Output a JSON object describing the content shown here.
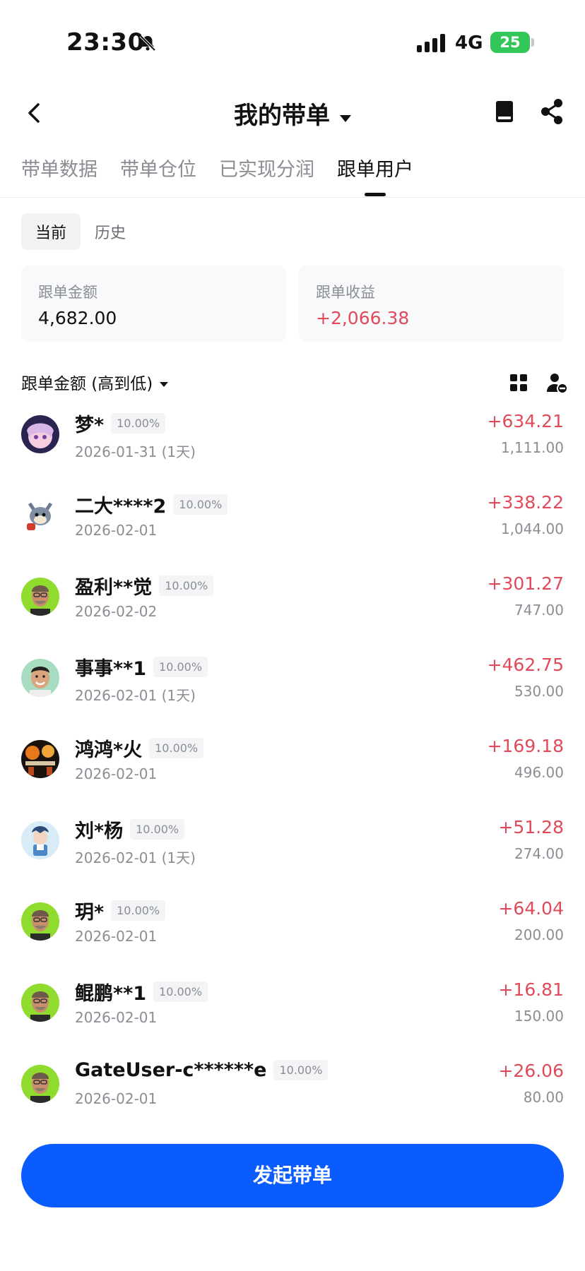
{
  "status_bar": {
    "time": "23:30",
    "network": "4G",
    "battery": "25"
  },
  "header": {
    "title": "我的带单"
  },
  "tabs": [
    {
      "label": "带单数据",
      "active": false
    },
    {
      "label": "带单仓位",
      "active": false
    },
    {
      "label": "已实现分润",
      "active": false
    },
    {
      "label": "跟单用户",
      "active": true
    }
  ],
  "segment": {
    "current": "当前",
    "history": "历史",
    "selected": "当前"
  },
  "summary": {
    "amount_label": "跟单金额",
    "amount_value": "4,682.00",
    "profit_label": "跟单收益",
    "profit_value": "+2,066.38"
  },
  "sort": {
    "label": "跟单金额 (高到低)"
  },
  "followers": [
    {
      "name": "梦*",
      "ratio": "10.00%",
      "date": "2026-01-31 (1天)",
      "profit": "+634.21",
      "amount": "1,111.00",
      "avatar": "anime-girl-avatar"
    },
    {
      "name": "二大****2",
      "ratio": "10.00%",
      "date": "2026-02-01",
      "profit": "+338.22",
      "amount": "1,044.00",
      "avatar": "cartoon-cat-avatar"
    },
    {
      "name": "盈利**觉",
      "ratio": "10.00%",
      "date": "2026-02-02",
      "profit": "+301.27",
      "amount": "747.00",
      "avatar": "man-green-bg-avatar"
    },
    {
      "name": "事事**1",
      "ratio": "10.00%",
      "date": "2026-02-01 (1天)",
      "profit": "+462.75",
      "amount": "530.00",
      "avatar": "smiling-man-avatar"
    },
    {
      "name": "鸿鸿*火",
      "ratio": "10.00%",
      "date": "2026-02-01",
      "profit": "+169.18",
      "amount": "496.00",
      "avatar": "fire-scene-avatar"
    },
    {
      "name": "刘*杨",
      "ratio": "10.00%",
      "date": "2026-02-01 (1天)",
      "profit": "+51.28",
      "amount": "274.00",
      "avatar": "anime-boy-avatar"
    },
    {
      "name": "玥*",
      "ratio": "10.00%",
      "date": "2026-02-01",
      "profit": "+64.04",
      "amount": "200.00",
      "avatar": "man-green-bg-avatar"
    },
    {
      "name": "鲲鹏**1",
      "ratio": "10.00%",
      "date": "2026-02-01",
      "profit": "+16.81",
      "amount": "150.00",
      "avatar": "man-green-bg-avatar"
    },
    {
      "name": "GateUser-c******e",
      "ratio": "10.00%",
      "date": "2026-02-01",
      "profit": "+26.06",
      "amount": "80.00",
      "avatar": "man-green-bg-avatar"
    }
  ],
  "primary_action": {
    "label": "发起带单"
  },
  "colors": {
    "accent": "#0a5cff",
    "profit": "#e14a5a",
    "battery": "#32c759"
  }
}
